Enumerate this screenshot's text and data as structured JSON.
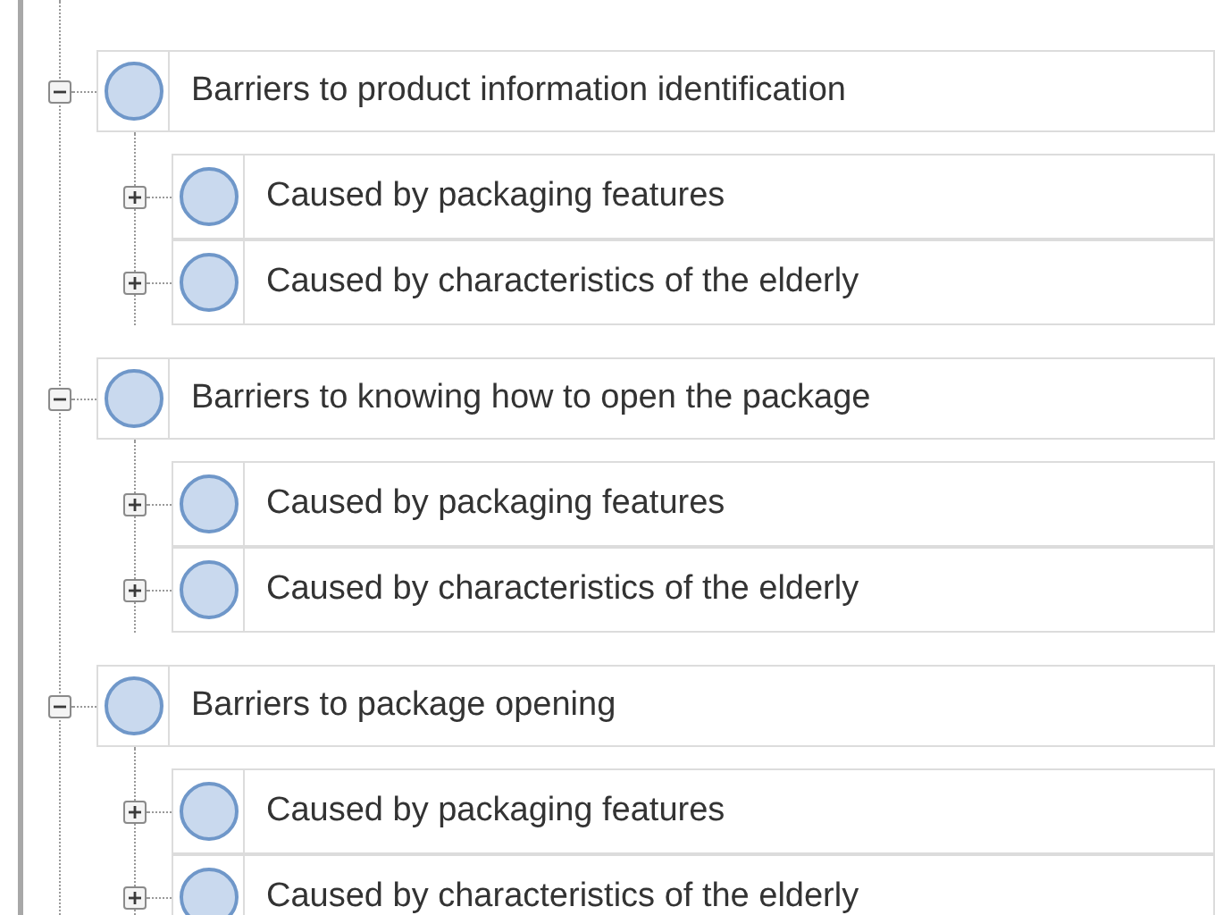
{
  "tree": [
    {
      "label": "Barriers to product information identification",
      "expanded": true,
      "children": [
        {
          "label": "Caused by packaging features",
          "expanded": false
        },
        {
          "label": "Caused by characteristics of the elderly",
          "expanded": false
        }
      ]
    },
    {
      "label": "Barriers to knowing how to open the package",
      "expanded": true,
      "children": [
        {
          "label": "Caused by packaging features",
          "expanded": false
        },
        {
          "label": "Caused by characteristics of the elderly",
          "expanded": false
        }
      ]
    },
    {
      "label": "Barriers to package opening",
      "expanded": true,
      "children": [
        {
          "label": "Caused by packaging features",
          "expanded": false
        },
        {
          "label": "Caused by characteristics of the elderly",
          "expanded": false
        }
      ]
    }
  ]
}
